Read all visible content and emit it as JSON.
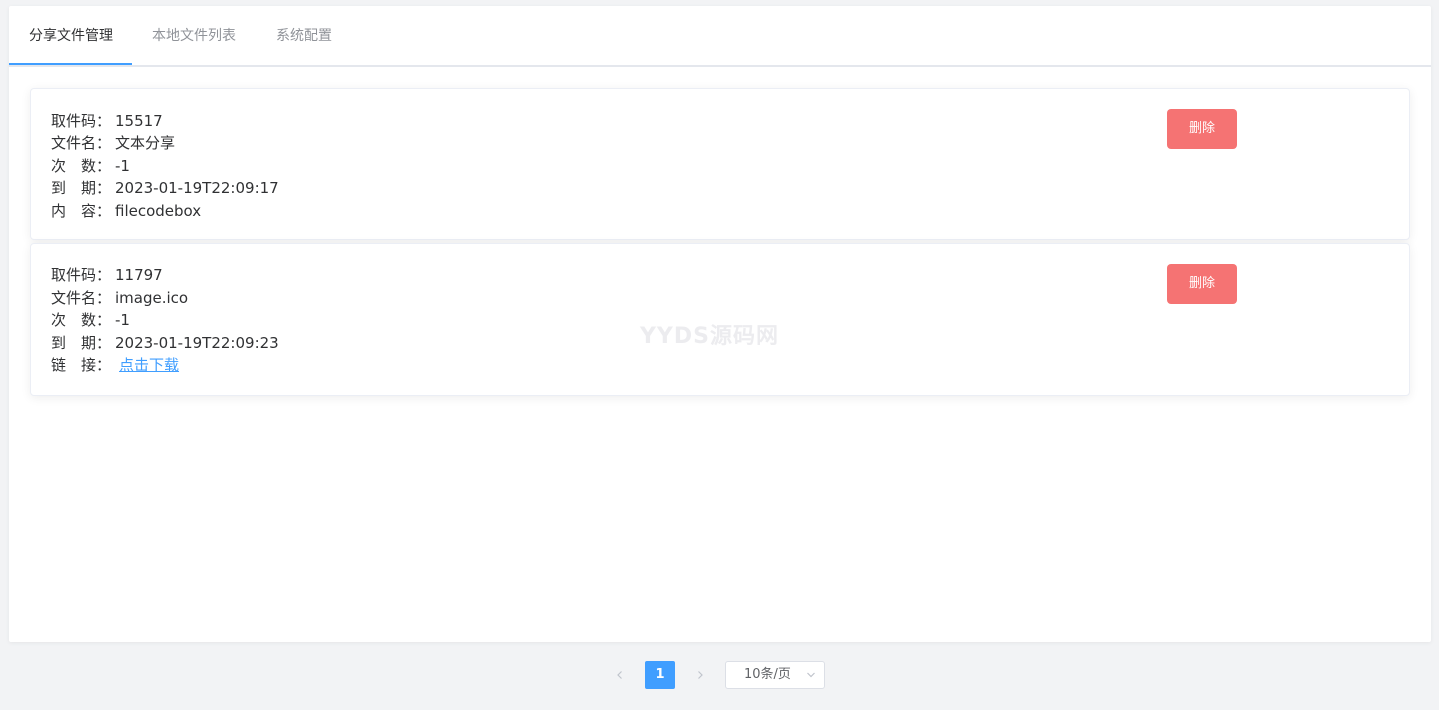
{
  "tabs": [
    {
      "label": "分享文件管理",
      "active": true
    },
    {
      "label": "本地文件列表",
      "active": false
    },
    {
      "label": "系统配置",
      "active": false
    }
  ],
  "cards": [
    {
      "code_label": "取件码：",
      "code": "15517",
      "name_label": "文件名：",
      "name": "文本分享",
      "count_label": "次　数：",
      "count": "-1",
      "expire_label": "到　期：",
      "expire": "2023-01-19T22:09:17",
      "content_label": "内　容：",
      "content": "filecodebox",
      "delete_label": "删除"
    },
    {
      "code_label": "取件码：",
      "code": "11797",
      "name_label": "文件名：",
      "name": "image.ico",
      "count_label": "次　数：",
      "count": "-1",
      "expire_label": "到　期：",
      "expire": "2023-01-19T22:09:23",
      "link_label": "链　接：",
      "link_text": "点击下载",
      "delete_label": "删除"
    }
  ],
  "watermark": "YYDS源码网",
  "pagination": {
    "prev_icon": "chevron-left-icon",
    "current_page": "1",
    "next_icon": "chevron-right-icon",
    "page_size": "10条/页"
  },
  "colors": {
    "accent": "#409eff",
    "danger": "#f56c6c"
  }
}
